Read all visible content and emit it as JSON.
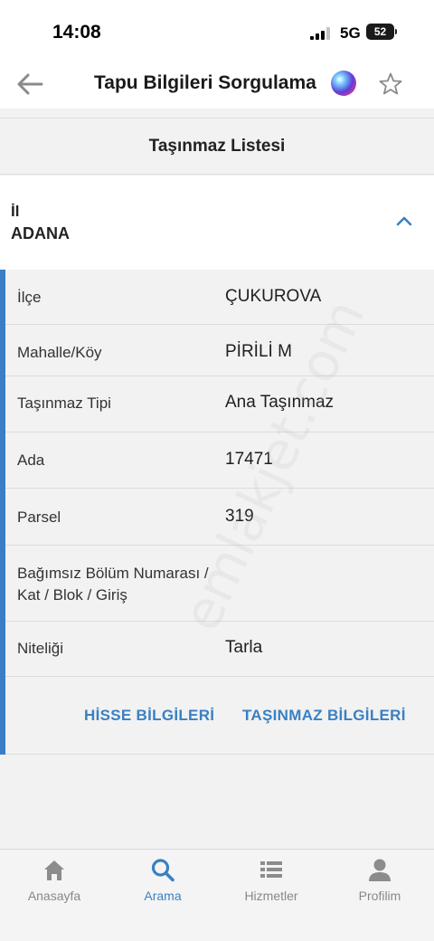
{
  "status_bar": {
    "time": "14:08",
    "network": "5G",
    "battery": "52"
  },
  "nav": {
    "title": "Tapu Bilgileri Sorgulama",
    "back_icon": "arrow-left-icon",
    "favorite_icon": "star-outline-icon"
  },
  "section": {
    "title": "Taşınmaz Listesi"
  },
  "il": {
    "label": "İl",
    "value": "ADANA"
  },
  "details": [
    {
      "label": "İlçe",
      "value": "ÇUKUROVA"
    },
    {
      "label": "Mahalle/Köy",
      "value": "PİRİLİ M"
    },
    {
      "label": "Taşınmaz Tipi",
      "value": "Ana Taşınmaz"
    },
    {
      "label": "Ada",
      "value": "17471"
    },
    {
      "label": "Parsel",
      "value": "319"
    },
    {
      "label": "Bağımsız Bölüm Numarası / Kat / Blok / Giriş",
      "value": ""
    },
    {
      "label": "Niteliği",
      "value": "Tarla"
    }
  ],
  "actions": {
    "hisse": "HİSSE BİLGİLERİ",
    "tasinmaz": "TAŞINMAZ BİLGİLERİ"
  },
  "watermark": "emlakjet.com",
  "tabs": [
    {
      "label": "Anasayfa",
      "icon": "home-icon"
    },
    {
      "label": "Arama",
      "icon": "search-icon"
    },
    {
      "label": "Hizmetler",
      "icon": "list-icon"
    },
    {
      "label": "Profilim",
      "icon": "person-icon"
    }
  ],
  "colors": {
    "accent": "#3a80c3",
    "active_bar": "#3a7ec8",
    "background": "#f2f2f2"
  }
}
